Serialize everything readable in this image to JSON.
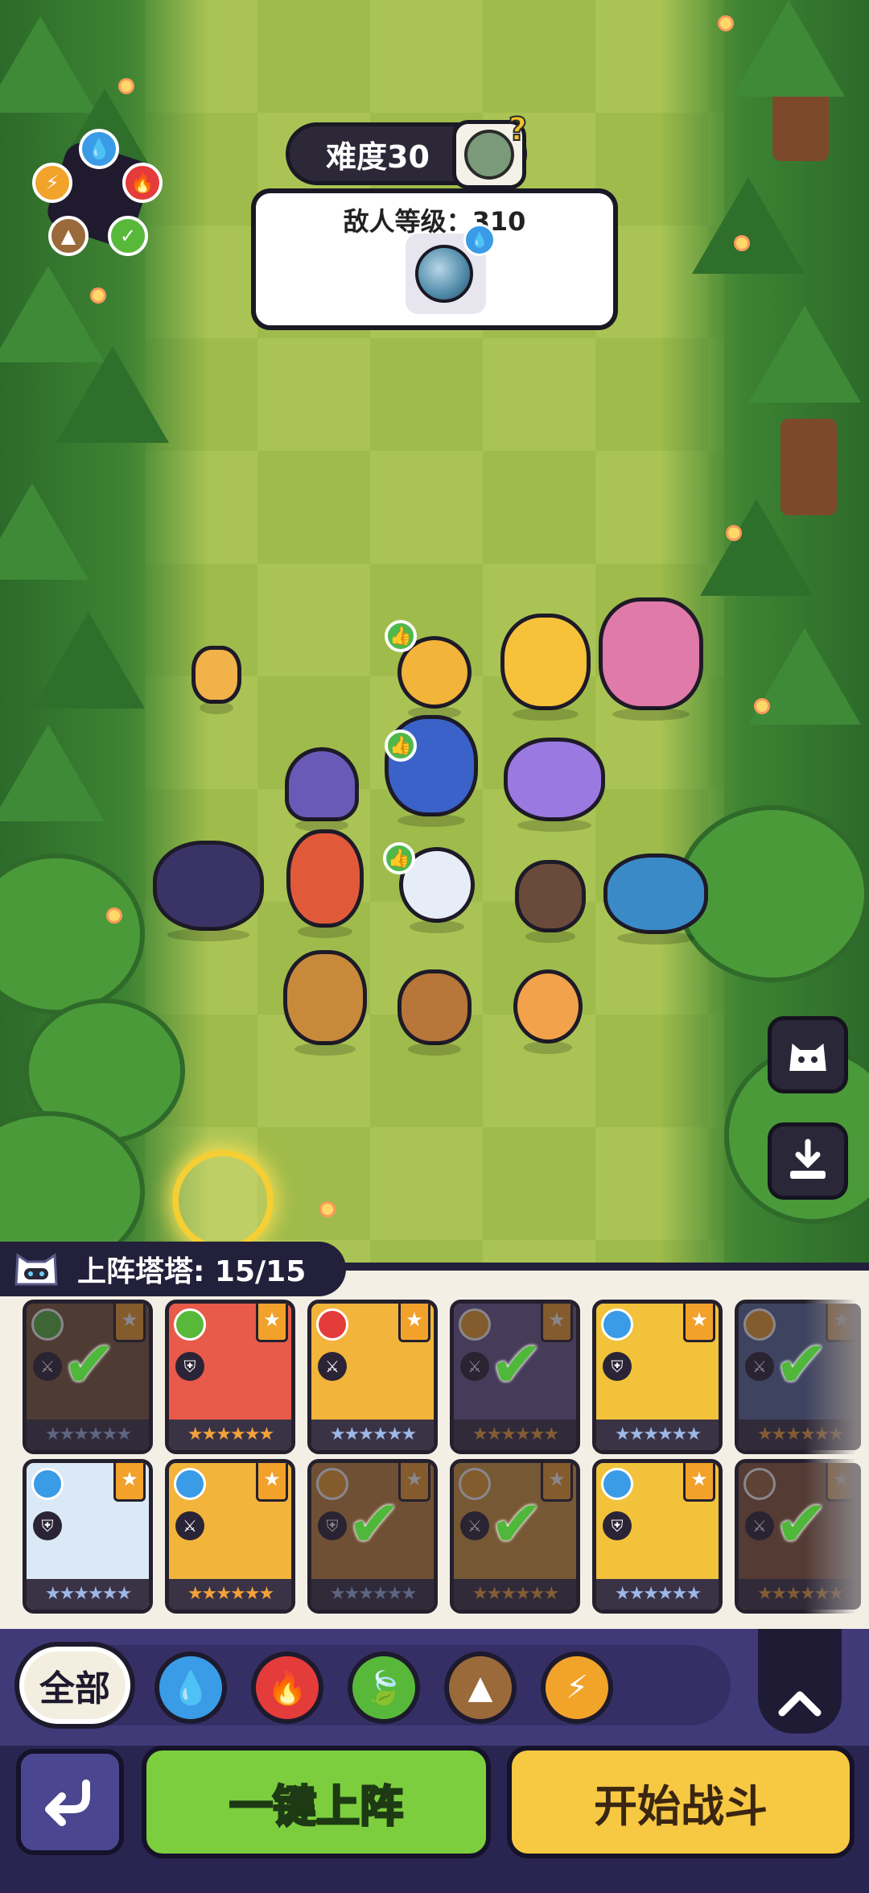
{
  "header": {
    "difficulty": "难度30",
    "enemy_level": "敌人等级：310"
  },
  "element_wheel": {
    "elements": [
      "water",
      "fire",
      "nature",
      "earth",
      "thunder"
    ]
  },
  "lineup": {
    "label": "上阵塔塔: 15/15"
  },
  "cards": [
    {
      "element": "nature",
      "role": "sword",
      "stars": 6,
      "deployed": true,
      "bg": "#7a5a3a"
    },
    {
      "element": "nature",
      "role": "shield",
      "stars": 6,
      "deployed": false,
      "bg": "#e85a4a"
    },
    {
      "element": "fire",
      "role": "sword",
      "stars": 6,
      "deployed": false,
      "bg": "#f2b43a"
    },
    {
      "element": "thunder",
      "role": "sword",
      "stars": 6,
      "deployed": true,
      "bg": "#6a5a8a"
    },
    {
      "element": "water",
      "role": "shield",
      "stars": 6,
      "deployed": false,
      "bg": "#f2c23a"
    },
    {
      "element": "thunder",
      "role": "sword",
      "stars": 6,
      "deployed": true,
      "bg": "#5a6a9a"
    },
    {
      "element": "water",
      "role": "shield",
      "stars": 6,
      "deployed": false,
      "bg": "#dbe9f6"
    },
    {
      "element": "water",
      "role": "sword",
      "stars": 6,
      "deployed": false,
      "bg": "#f2b43a"
    },
    {
      "element": "thunder",
      "role": "shield",
      "stars": 6,
      "deployed": true,
      "bg": "#c7873a"
    },
    {
      "element": "thunder",
      "role": "sword",
      "stars": 6,
      "deployed": true,
      "bg": "#d49a3a"
    },
    {
      "element": "water",
      "role": "shield",
      "stars": 6,
      "deployed": false,
      "bg": "#f2c23a"
    },
    {
      "element": "earth",
      "role": "sword",
      "stars": 6,
      "deployed": true,
      "bg": "#8a5a3a"
    }
  ],
  "filters": {
    "all_label": "全部",
    "items": [
      "water",
      "fire",
      "nature",
      "earth",
      "thunder"
    ]
  },
  "actions": {
    "deploy_label": "一键上阵",
    "start_label": "开始战斗"
  },
  "colors": {
    "water": "#3a9be6",
    "fire": "#e43b3b",
    "nature": "#58b83a",
    "earth": "#9b6a3a",
    "thunder": "#f2a32a",
    "deploy_green": "#7cce3e",
    "start_yellow": "#f7c842"
  }
}
